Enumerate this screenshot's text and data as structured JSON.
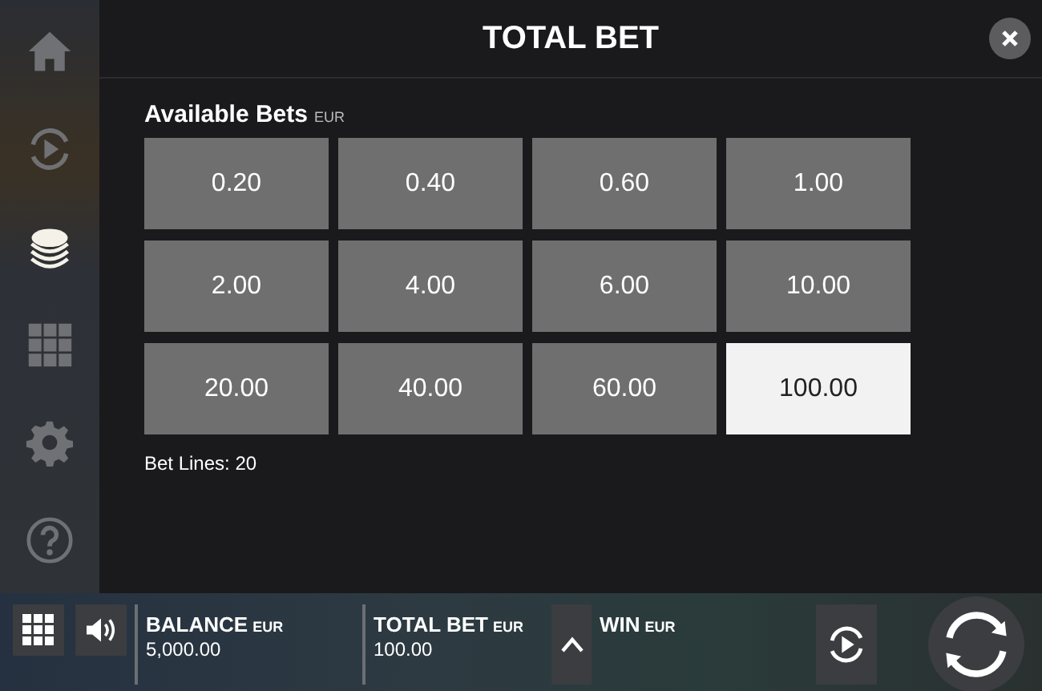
{
  "sidebar": {
    "items": [
      {
        "kind": "home",
        "selected": false
      },
      {
        "kind": "autoplay",
        "selected": false
      },
      {
        "kind": "coins",
        "selected": true
      },
      {
        "kind": "grid",
        "selected": false
      },
      {
        "kind": "settings",
        "selected": false
      },
      {
        "kind": "help",
        "selected": false
      }
    ]
  },
  "panel": {
    "title": "TOTAL BET",
    "section_label": "Available Bets",
    "section_currency": "EUR",
    "bets": [
      {
        "label": "0.20",
        "selected": false
      },
      {
        "label": "0.40",
        "selected": false
      },
      {
        "label": "0.60",
        "selected": false
      },
      {
        "label": "1.00",
        "selected": false
      },
      {
        "label": "2.00",
        "selected": false
      },
      {
        "label": "4.00",
        "selected": false
      },
      {
        "label": "6.00",
        "selected": false
      },
      {
        "label": "10.00",
        "selected": false
      },
      {
        "label": "20.00",
        "selected": false
      },
      {
        "label": "40.00",
        "selected": false
      },
      {
        "label": "60.00",
        "selected": false
      },
      {
        "label": "100.00",
        "selected": true
      }
    ],
    "bet_lines": "Bet Lines: 20"
  },
  "bottom_bar": {
    "balance": {
      "label": "BALANCE",
      "currency": "EUR",
      "value": "5,000.00"
    },
    "total_bet": {
      "label": "TOTAL BET",
      "currency": "EUR",
      "value": "100.00"
    },
    "win": {
      "label": "WIN",
      "currency": "EUR"
    }
  }
}
